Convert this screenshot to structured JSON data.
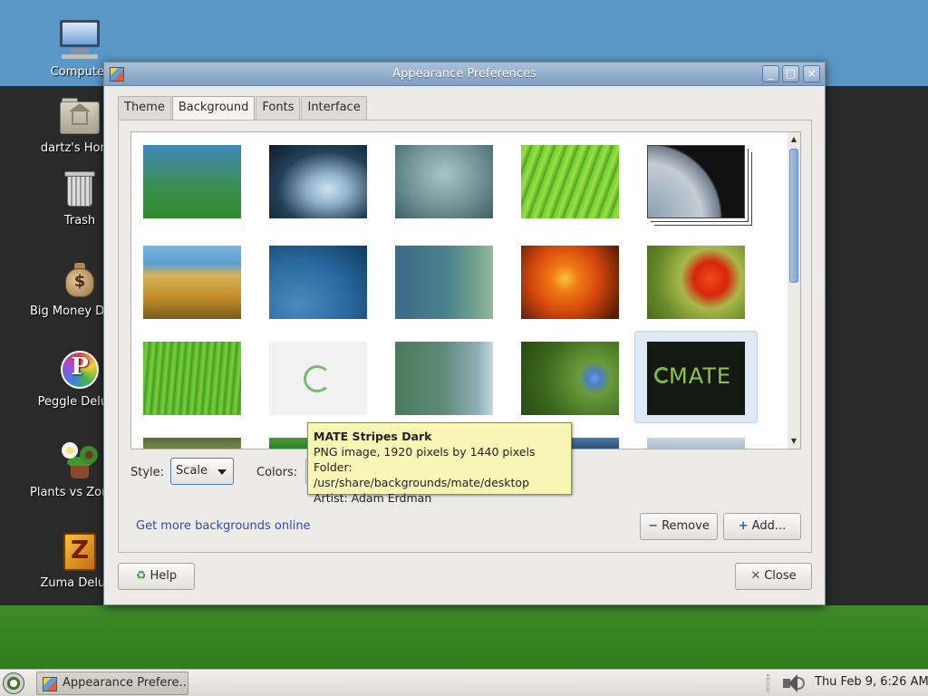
{
  "desktop": {
    "icons": [
      {
        "label": "Computer",
        "icon": "computer-icon"
      },
      {
        "label": "dartz's Home",
        "icon": "home-folder-icon"
      },
      {
        "label": "Trash",
        "icon": "trash-icon"
      },
      {
        "label": "Big Money Deluxe",
        "icon": "money-bag-icon"
      },
      {
        "label": "Peggle Deluxe",
        "icon": "peggle-icon"
      },
      {
        "label": "Plants vs Zombies",
        "icon": "plants-icon"
      },
      {
        "label": "Zuma Deluxe",
        "icon": "zuma-icon"
      }
    ]
  },
  "window": {
    "title": "Appearance Preferences",
    "tabs": [
      {
        "label": "Theme",
        "active": false
      },
      {
        "label": "Background",
        "active": true
      },
      {
        "label": "Fonts",
        "active": false
      },
      {
        "label": "Interface",
        "active": false
      }
    ],
    "style_label": "Style:",
    "style_value": "Scale",
    "colors_label": "Colors:",
    "more_link": "Get more backgrounds online",
    "remove_label": "Remove",
    "add_label": "Add...",
    "help_label": "Help",
    "close_label": "Close",
    "selected_wallpaper": "MATE Stripes Dark",
    "mate_logo_text": "MATE"
  },
  "tooltip": {
    "title": "MATE Stripes Dark",
    "line1": "PNG image, 1920 pixels by 1440 pixels",
    "line2": "Folder: /usr/share/backgrounds/mate/desktop",
    "line3": "Artist: Adam Erdman"
  },
  "taskbar": {
    "task_label": "Appearance Prefere...",
    "clock": "Thu Feb  9,  6:26 AM"
  },
  "colors": {
    "accent": "#7da5d6",
    "link": "#2c4fa8",
    "tooltip_bg": "#f8f6b4",
    "selection": "#dfe8f5"
  }
}
